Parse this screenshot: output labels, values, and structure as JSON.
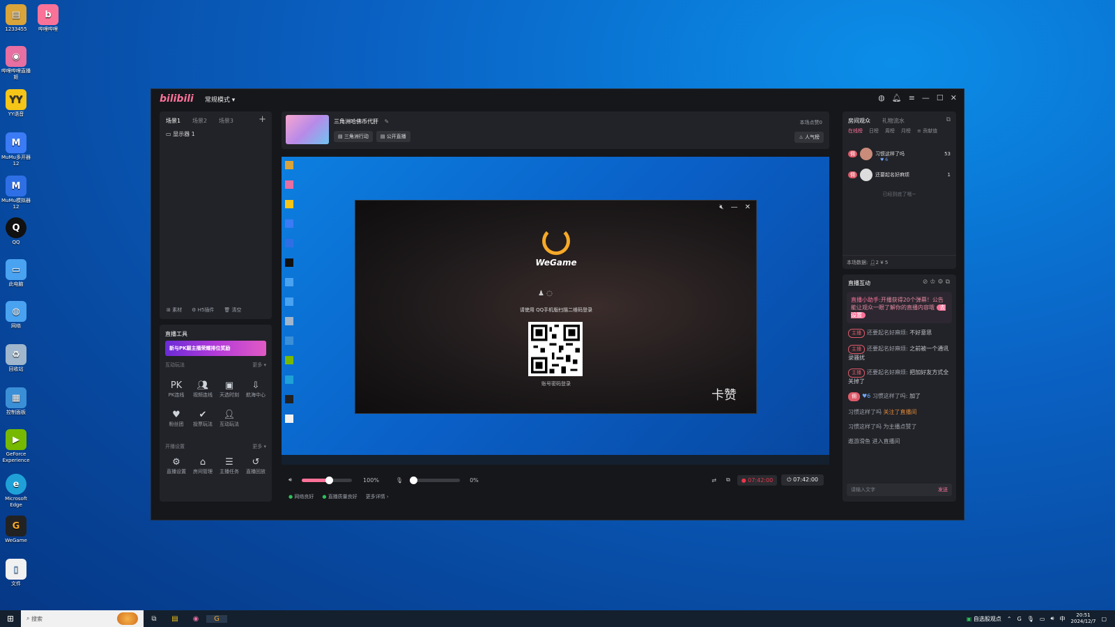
{
  "desktop": {
    "icons": [
      {
        "label": "1233455",
        "icon": "folder-icon",
        "color": "#d9a43a"
      },
      {
        "label": "哔哩哔哩",
        "icon": "bilibili-icon",
        "color": "#fb7299"
      },
      {
        "label": "哔哩哔哩直播姬",
        "icon": "bilibili-live-icon",
        "color": "#e76fa1"
      },
      {
        "label": "YY语音",
        "icon": "yy-icon",
        "color": "#f5c518"
      },
      {
        "label": "MuMu多开器12",
        "icon": "mumu-multi-icon",
        "color": "#3b7bf6"
      },
      {
        "label": "MuMu模拟器12",
        "icon": "mumu-icon",
        "color": "#2f6fe6"
      },
      {
        "label": "QQ",
        "icon": "qq-icon",
        "color": "#111111"
      },
      {
        "label": "此电脑",
        "icon": "computer-icon",
        "color": "#4aa3f0"
      },
      {
        "label": "网络",
        "icon": "network-icon",
        "color": "#4aa3f0"
      },
      {
        "label": "回收站",
        "icon": "recycle-bin-icon",
        "color": "#9fb6cc"
      },
      {
        "label": "控制面板",
        "icon": "control-panel-icon",
        "color": "#3b8fd6"
      },
      {
        "label": "GeForce Experience",
        "icon": "nvidia-icon",
        "color": "#76b900"
      },
      {
        "label": "Microsoft Edge",
        "icon": "edge-icon",
        "color": "#1fa1d8"
      },
      {
        "label": "WeGame",
        "icon": "wegame-icon",
        "color": "#222222"
      },
      {
        "label": "文件",
        "icon": "file-icon",
        "color": "#f1f1f1"
      }
    ]
  },
  "app": {
    "logo": "bilibili",
    "mode": "常规模式 ▾",
    "scenes": [
      "场景1",
      "场景2",
      "场景3"
    ],
    "add_scene": "+",
    "source_item": "显示器 1",
    "source_actions": [
      "素材",
      "H5插件",
      "清空"
    ],
    "tools": {
      "title": "直播工具",
      "banner": "新与PK巅主播荣耀排位奖励",
      "interact_title": "互动玩法",
      "more": "更多 ▾",
      "interact_items": [
        "PK连线",
        "视频连线",
        "天选时刻",
        "航海中心",
        "粉丝团",
        "投票玩法",
        "互动玩法"
      ],
      "broadcast_title": "开播设置",
      "broadcast_items": [
        "直播设置",
        "房间管理",
        "主播任务",
        "直播回放"
      ]
    },
    "room": {
      "title": "三角洲哈佛币代肝",
      "category": "三角洲行动",
      "visibility": "公开直播",
      "likes_label": "本场点赞0",
      "popularity": "人气榜"
    },
    "controls": {
      "volume_pct": "100%",
      "volume_level": 1.0,
      "mic_pct": "0%",
      "mic_level": 0.0,
      "timer_live": "07:42:00",
      "timer": "07:42:00",
      "status_net": "网络良好",
      "status_quality": "直播质量良好",
      "more_details": "更多详情 ›"
    },
    "audience": {
      "tabs": [
        "房间观众",
        "礼物流水"
      ],
      "subtabs": [
        "在线榜",
        "日榜",
        "周榜",
        "月榜",
        "≡ 贡献值"
      ],
      "rows": [
        {
          "rank_badge": "佣",
          "name": "习惯这样了吗",
          "level": "6",
          "score": "53"
        },
        {
          "rank_badge": "佣",
          "name": "还要起名好麻烦",
          "level": "",
          "score": "1"
        }
      ],
      "end_note": "已经到底了哦~",
      "stats_label": "本场数据:",
      "stats_viewers": "2",
      "stats_gold": "5"
    },
    "interaction": {
      "title": "直播互动",
      "helper_name": "直播小助手:",
      "helper_text": "开播获得20个弹幕！公告能让观众一眼了解你的直播内容哦",
      "helper_action": "去设置",
      "messages": [
        {
          "tag": "主播",
          "name": "还要起名好麻烦:",
          "text": "不好意思"
        },
        {
          "tag": "主播",
          "name": "还要起名好麻烦:",
          "text": "之前被一个通讯录骚扰"
        },
        {
          "tag": "主播",
          "name": "还要起名好麻烦:",
          "text": "把加好友方式全关掉了"
        },
        {
          "tag": "佣",
          "name": "习惯这样了吗:",
          "text": "加了"
        }
      ],
      "events": [
        {
          "name": "习惯这样了吗",
          "text": "关注了直播间"
        },
        {
          "name": "习惯这样了吗",
          "text": "为主播点赞了"
        },
        {
          "name": "遨游滑鱼",
          "text": "进入直播间"
        }
      ],
      "input_placeholder": "请输入文字",
      "send": "发送"
    },
    "preview": {
      "wegame_logo": "WeGame",
      "login_hint": "请使用 QQ手机版扫描二维码登录",
      "password_login": "账号密码登录",
      "watermark": "卡赞"
    }
  },
  "taskbar": {
    "search_placeholder": "搜索",
    "tray_item": "自选股观点",
    "ime": "中",
    "time": "20:51",
    "date": "2024/12/7"
  },
  "colors": {
    "accent": "#fb7299",
    "live_red": "#e8364a",
    "status_green": "#2fbf5a"
  }
}
